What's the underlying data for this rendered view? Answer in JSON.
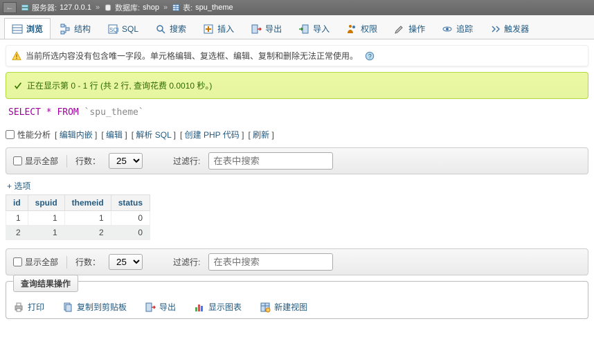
{
  "breadcrumb": {
    "server_label": "服务器:",
    "server_value": "127.0.0.1",
    "db_label": "数据库:",
    "db_value": "shop",
    "table_label": "表:",
    "table_value": "spu_theme"
  },
  "tabs": {
    "browse": "浏览",
    "structure": "结构",
    "sql": "SQL",
    "search": "搜索",
    "insert": "插入",
    "export": "导出",
    "import": "导入",
    "privileges": "权限",
    "operations": "操作",
    "tracking": "追踪",
    "triggers": "触发器"
  },
  "notice": {
    "text": "当前所选内容没有包含唯一字段。单元格编辑、复选框、编辑、复制和删除无法正常使用。"
  },
  "success": {
    "text": "正在显示第 0 - 1 行 (共 2 行, 查询花费 0.0010 秒。)"
  },
  "sql": {
    "select": "SELECT",
    "star": "*",
    "from": "FROM",
    "table": "`spu_theme`"
  },
  "sql_actions": {
    "profiling": "性能分析",
    "edit_inline": "编辑内嵌",
    "edit": "编辑",
    "explain": "解析 SQL",
    "create_php": "创建 PHP 代码",
    "refresh": "刷新"
  },
  "toolbar": {
    "show_all": "显示全部",
    "rows_label": "行数：",
    "rows_value": "25",
    "filter_label": "过滤行:",
    "filter_placeholder": "在表中搜索"
  },
  "options_link": "+ 选项",
  "table": {
    "headers": [
      "id",
      "spuid",
      "themeid",
      "status"
    ],
    "rows": [
      [
        "1",
        "1",
        "1",
        "0"
      ],
      [
        "2",
        "1",
        "2",
        "0"
      ]
    ]
  },
  "result_ops": {
    "legend": "查询结果操作",
    "print": "打印",
    "copy": "复制到剪贴板",
    "export": "导出",
    "chart": "显示图表",
    "create_view": "新建视图"
  }
}
